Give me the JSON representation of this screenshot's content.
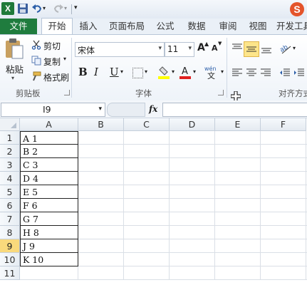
{
  "qat": {
    "app_logo": "X",
    "save_icon": "save-icon",
    "undo_icon": "undo-icon",
    "redo_icon": "redo-icon",
    "ime_logo": "S"
  },
  "tabs": [
    {
      "label": "文件"
    },
    {
      "label": "开始"
    },
    {
      "label": "插入"
    },
    {
      "label": "页面布局"
    },
    {
      "label": "公式"
    },
    {
      "label": "数据"
    },
    {
      "label": "审阅"
    },
    {
      "label": "视图"
    },
    {
      "label": "开发工具"
    }
  ],
  "ribbon": {
    "clipboard": {
      "paste": "粘贴",
      "cut": "剪切",
      "copy": "复制",
      "format_painter": "格式刷",
      "group_label": "剪贴板"
    },
    "font": {
      "name": "宋体",
      "size": "11",
      "grow": "A",
      "shrink": "A",
      "bold": "B",
      "italic": "I",
      "underline": "U",
      "phonetic": "wén",
      "group_label": "字体"
    },
    "alignment": {
      "group_label": "对齐方式"
    }
  },
  "formula_bar": {
    "name_box": "I9",
    "fx": "fx",
    "formula": ""
  },
  "columns": [
    "A",
    "B",
    "C",
    "D",
    "E",
    "F"
  ],
  "rows": [
    "1",
    "2",
    "3",
    "4",
    "5",
    "6",
    "7",
    "8",
    "9",
    "10",
    "11"
  ],
  "selected_row": "9",
  "cells_A": [
    "A 1",
    "B 2",
    "C 3",
    "D 4",
    "E 5",
    "F 6",
    "G 7",
    "H 8",
    "J 9",
    "K 10",
    ""
  ],
  "colors": {
    "file_tab": "#1f7c3e",
    "selected_row_header": "#f9d97c",
    "highlight_button": "#fde58a"
  }
}
